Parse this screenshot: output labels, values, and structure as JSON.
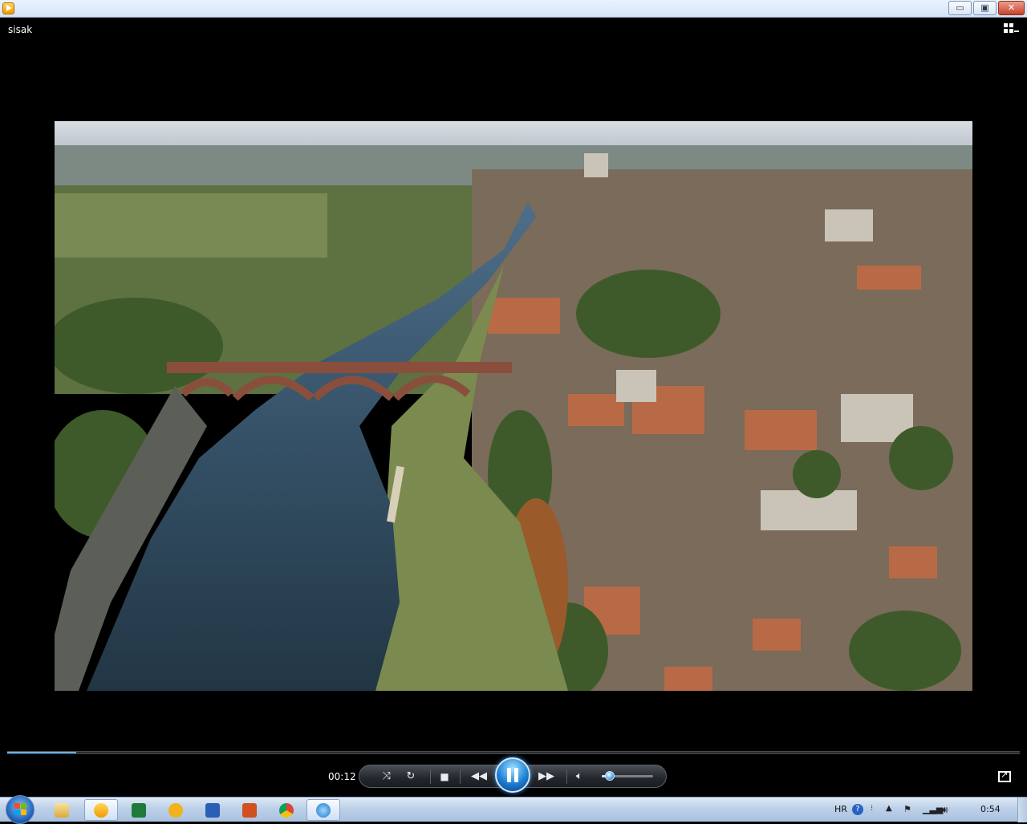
{
  "window": {
    "minimize_label": "▭",
    "maximize_label": "▣",
    "close_label": "✕"
  },
  "media": {
    "title": "sisak"
  },
  "playback": {
    "elapsed": "00:12",
    "progress_fraction": 0.068,
    "volume_fraction": 0.2
  },
  "taskbar": {
    "language": "HR",
    "clock": "0:54",
    "apps": [
      {
        "icon": "file-explorer-icon"
      },
      {
        "icon": "windows-media-player-icon"
      },
      {
        "icon": "excel-icon"
      },
      {
        "icon": "clock-app-icon"
      },
      {
        "icon": "word-icon"
      },
      {
        "icon": "powerpoint-icon"
      },
      {
        "icon": "chrome-icon"
      },
      {
        "icon": "internet-explorer-icon"
      }
    ]
  },
  "colors": {
    "accent": "#2b8ddc",
    "background": "#000000"
  }
}
